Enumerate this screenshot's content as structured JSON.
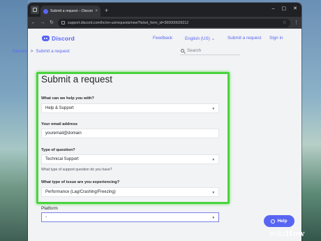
{
  "browser": {
    "tab_title": "Submit a request – Discord",
    "tab_close": "×",
    "new_tab": "+",
    "controls": {
      "minimize": "–",
      "maximize": "▢",
      "close": "✕"
    },
    "url": "support.discord.com/hc/en-us/requests/new?ticket_form_id=360000029212",
    "back": "←",
    "forward": "→",
    "reload": "↻",
    "bookmark": "☆",
    "menu": "⋮"
  },
  "header": {
    "logo_text": "Discord",
    "nav": [
      "Feedback",
      "English (US) ⌄",
      "Submit a request",
      "Sign in"
    ]
  },
  "breadcrumb": {
    "home": "Discord",
    "sep": ">",
    "current": "Submit a request"
  },
  "search": {
    "placeholder": "Search"
  },
  "form": {
    "title": "Submit a request",
    "q1": {
      "label": "What can we help you with?",
      "value": "Help & Support"
    },
    "q2": {
      "label": "Your email address",
      "value": "youremail@domain"
    },
    "q3": {
      "label": "Type of question?",
      "value": "Technical Support",
      "hint": "What type of support question do you have?"
    },
    "q4": {
      "label": "What type of issue are you experiencing?",
      "value": "Performance (Lag/Crashing/Freezing)"
    },
    "q5": {
      "label": "Platform",
      "value": "-"
    },
    "caret": "▼"
  },
  "help_button": {
    "label": "Help"
  },
  "watermark": {
    "wiki": "wiki",
    "how": "How"
  },
  "colors": {
    "accent": "#5865f2",
    "highlight": "#49d43e"
  }
}
